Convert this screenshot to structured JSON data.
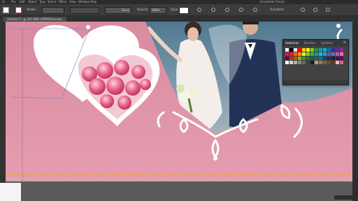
{
  "menubar": {
    "items": [
      "Ai",
      "File",
      "Edit",
      "Object",
      "Type",
      "Select",
      "Effect",
      "View",
      "Window",
      "Help"
    ],
    "right_label": "Essentials Classic"
  },
  "controlbar": {
    "stroke_label": "Stroke:",
    "basic_label": "Basic",
    "opacity_label": "Opacity:",
    "opacity_value": "100%",
    "style_label": "Style:",
    "transform_label": "Transform"
  },
  "document_tab": {
    "title": "Untitled-1* @ 202.98% (CMYK/Preview)"
  },
  "swatches_panel": {
    "tabs": [
      "Swatches",
      "Brushes",
      "Symbols"
    ],
    "menu_glyph": "≡",
    "colors": [
      "#ffffff",
      "#000000",
      "#e8e8e8",
      "#ff0000",
      "#ffcc00",
      "#ffff00",
      "#99cc00",
      "#00a651",
      "#00a99d",
      "#00aeef",
      "#0072bc",
      "#2e3192",
      "#662d91",
      "#92278f",
      "#ec008c",
      "#ed1c24",
      "#f26522",
      "#f7941d",
      "#fff200",
      "#8dc63f",
      "#39b54a",
      "#00a99d",
      "#00bff3",
      "#448ccb",
      "#605ca8",
      "#8560a8",
      "#a864a8",
      "#f06eaa",
      "#7d0000",
      "#a0410d",
      "#a36209",
      "#aba000",
      "#598527",
      "#1a7b30",
      "#007236",
      "#00746b",
      "#0076a3",
      "#004a80",
      "#003471",
      "#1b1464",
      "#440e62",
      "#630460",
      "#ffffff",
      "#d9d9d9",
      "#b3b3b3",
      "#8c8c8c",
      "#666666",
      "#404040",
      "#1a1a1a",
      "#c69c6d",
      "#a67c52",
      "#8c6239",
      "#754c24",
      "#603913",
      "#ffb6c1",
      "#e85d8a"
    ]
  },
  "icons": {
    "tools": "selection-tool",
    "panel_menu": "panel-menu-icon"
  },
  "colors": {
    "background_pink": "#d98ba0",
    "heart_white": "#ffffff",
    "guide_orange": "#f0a030",
    "suit_navy": "#233257"
  }
}
